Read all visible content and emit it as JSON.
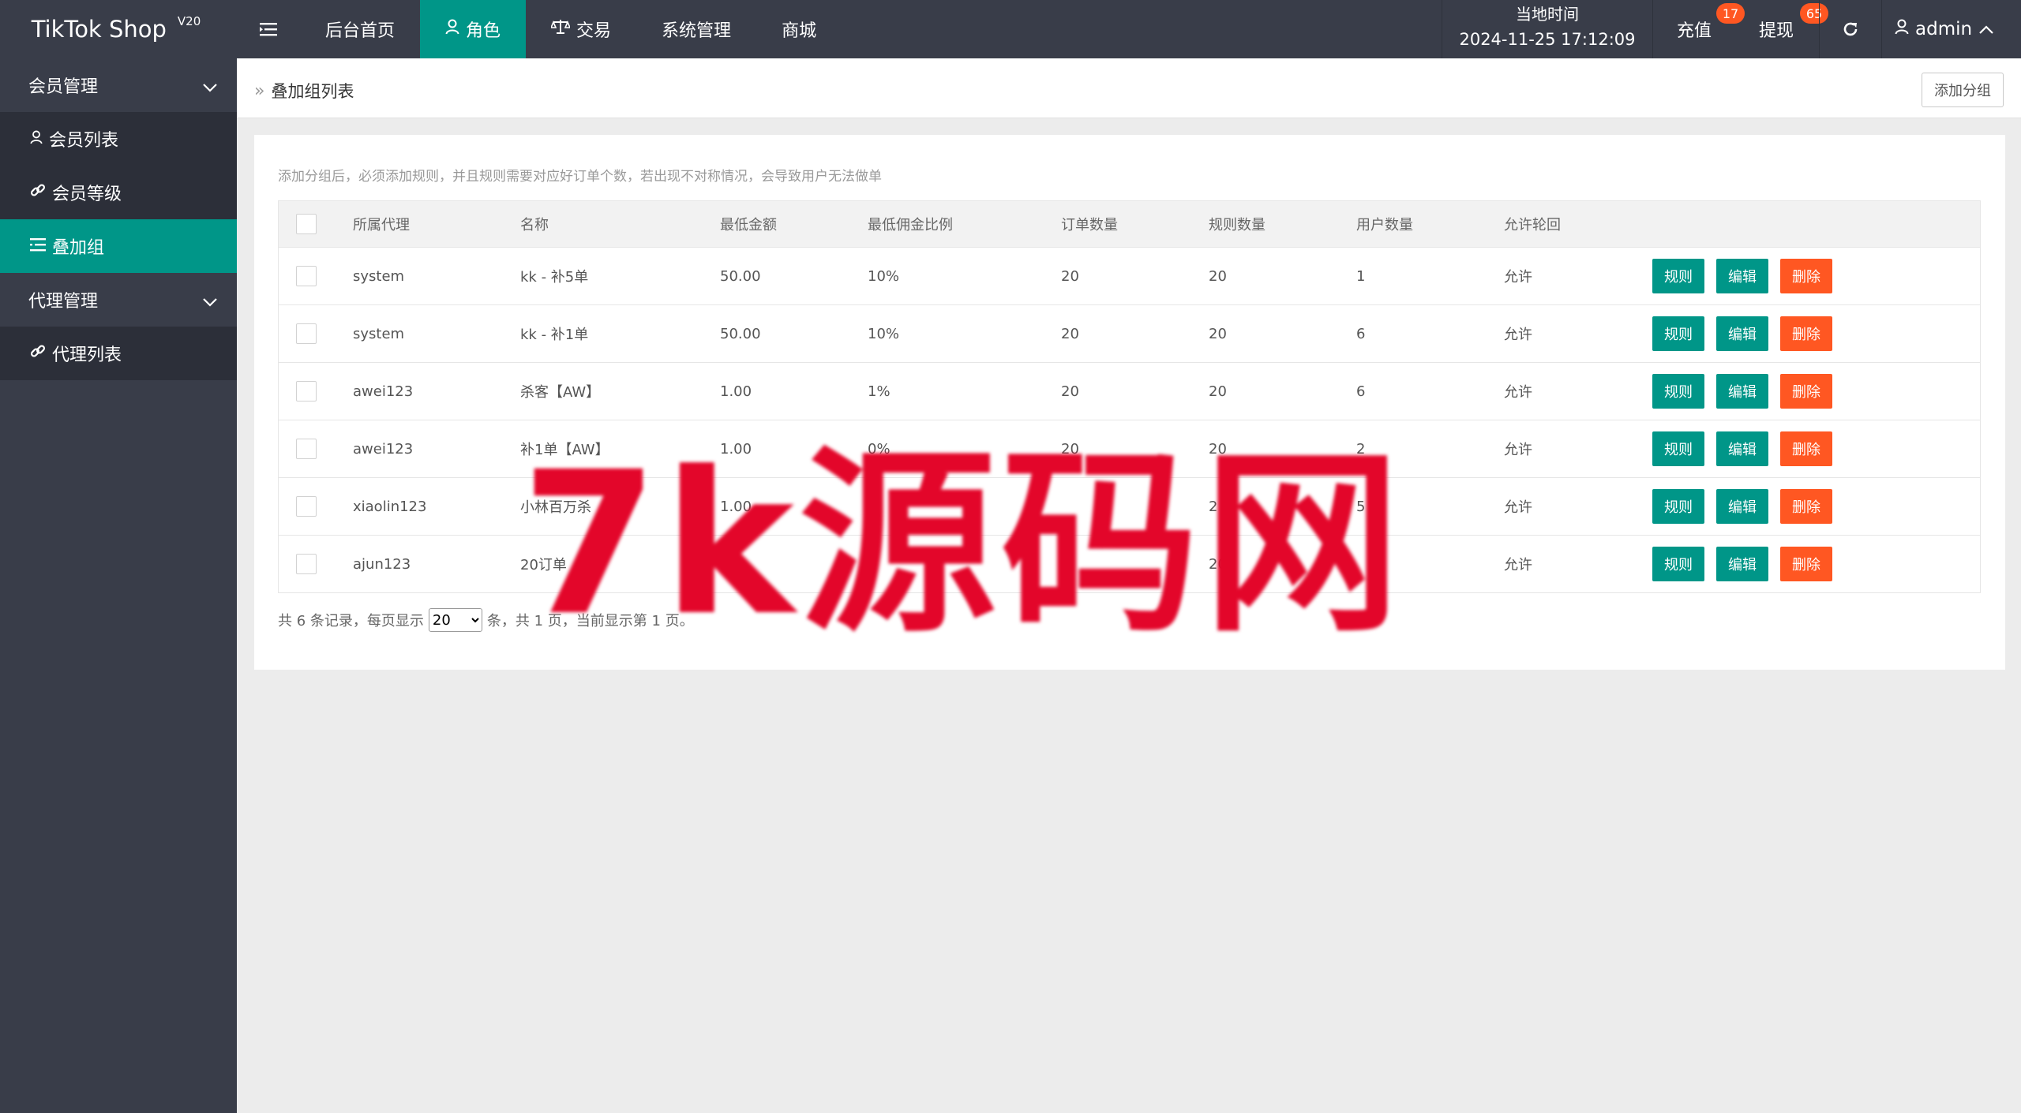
{
  "app": {
    "name": "TikTok Shop",
    "version": "V20"
  },
  "nav": [
    {
      "label": "后台首页",
      "active": false,
      "icon": ""
    },
    {
      "label": "角色",
      "active": true,
      "icon": "user-icon"
    },
    {
      "label": "交易",
      "active": false,
      "icon": "scale-icon"
    },
    {
      "label": "系统管理",
      "active": false,
      "icon": ""
    },
    {
      "label": "商城",
      "active": false,
      "icon": ""
    }
  ],
  "topbar": {
    "time_label": "当地时间",
    "time_value": "2024-11-25 17:12:09",
    "recharge_label": "充值",
    "recharge_badge": "17",
    "withdraw_label": "提现",
    "withdraw_badge": "65",
    "user": "admin"
  },
  "sidebar": {
    "groups": [
      {
        "label": "会员管理",
        "items": [
          {
            "label": "会员列表",
            "icon": "user-icon",
            "active": false
          },
          {
            "label": "会员等级",
            "icon": "link-icon",
            "active": false
          },
          {
            "label": "叠加组",
            "icon": "list-icon",
            "active": true
          }
        ]
      },
      {
        "label": "代理管理",
        "items": [
          {
            "label": "代理列表",
            "icon": "link-icon",
            "active": false
          }
        ]
      }
    ]
  },
  "page": {
    "breadcrumb": "叠加组列表",
    "add_button": "添加分组",
    "tip": "添加分组后，必须添加规则，并且规则需要对应好订单个数，若出现不对称情况，会导致用户无法做单"
  },
  "table": {
    "columns": [
      "所属代理",
      "名称",
      "最低金额",
      "最低佣金比例",
      "订单数量",
      "规则数量",
      "用户数量",
      "允许轮回"
    ],
    "rows": [
      {
        "agent": "system",
        "name": "kk - 补5单",
        "min_amount": "50.00",
        "min_rate": "10%",
        "orders": "20",
        "rules": "20",
        "users": "1",
        "loop": "允许"
      },
      {
        "agent": "system",
        "name": "kk - 补1单",
        "min_amount": "50.00",
        "min_rate": "10%",
        "orders": "20",
        "rules": "20",
        "users": "6",
        "loop": "允许"
      },
      {
        "agent": "awei123",
        "name": "杀客【AW】",
        "min_amount": "1.00",
        "min_rate": "1%",
        "orders": "20",
        "rules": "20",
        "users": "6",
        "loop": "允许"
      },
      {
        "agent": "awei123",
        "name": "补1单【AW】",
        "min_amount": "1.00",
        "min_rate": "0%",
        "orders": "20",
        "rules": "20",
        "users": "2",
        "loop": "允许"
      },
      {
        "agent": "xiaolin123",
        "name": "小林百万杀",
        "min_amount": "1.00",
        "min_rate": "",
        "orders": "",
        "rules": "2",
        "users": "5",
        "loop": "允许"
      },
      {
        "agent": "ajun123",
        "name": "20订单",
        "min_amount": "",
        "min_rate": "0",
        "orders": "0",
        "rules": "20",
        "users": "",
        "loop": "允许"
      }
    ],
    "actions": {
      "rule": "规则",
      "edit": "编辑",
      "delete": "删除"
    }
  },
  "pager": {
    "prefix": "共 6 条记录，每页显示",
    "page_size": "20",
    "suffix": "条，共 1 页，当前显示第 1 页。"
  },
  "watermark": "7k源码网",
  "colors": {
    "accent": "#009688",
    "danger": "#ff5722",
    "topbar": "#393d49",
    "watermark": "#e3062a"
  }
}
